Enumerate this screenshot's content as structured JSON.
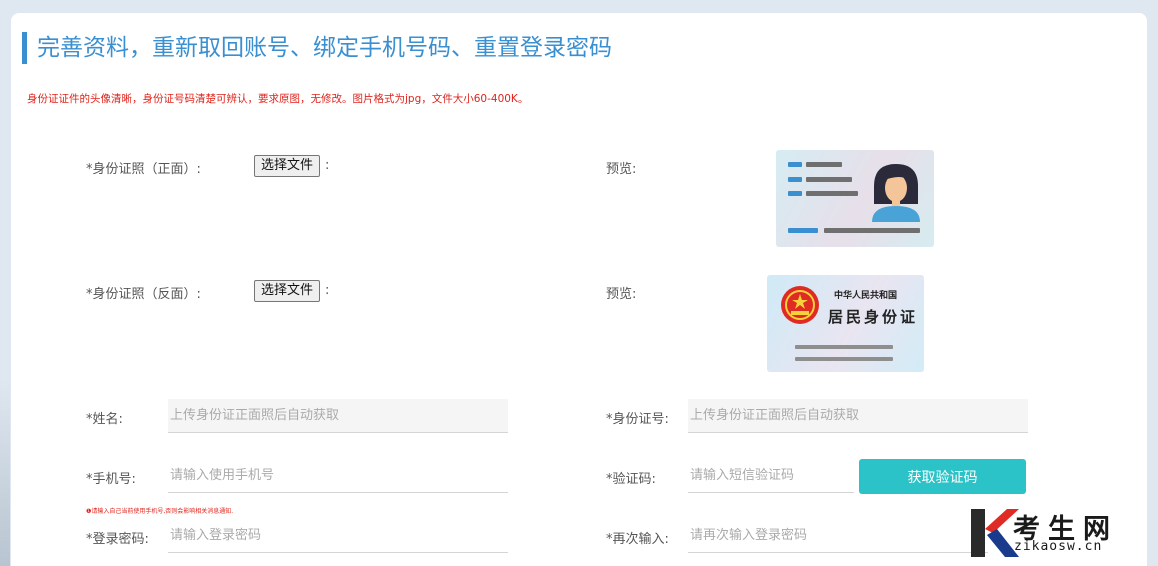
{
  "header": {
    "title": "完善资料，重新取回账号、绑定手机号码、重置登录密码",
    "notice": "身份证证件的头像清晰，身份证号码清楚可辨认，要求原图，无修改。图片格式为jpg，文件大小60-400K。"
  },
  "upload": {
    "front_label": "*身份证照（正面）:",
    "back_label": "*身份证照（反面）:",
    "choose_file": "选择文件",
    "colon": ":",
    "preview_label": "预览:"
  },
  "front_card": {
    "colors": [
      "#3a8fd0",
      "#6f6f6f",
      "#f5c59a",
      "#2a2a3a",
      "#4aa3d6"
    ]
  },
  "back_card": {
    "line1": "中华人民共和国",
    "line2": "居民身份证",
    "colors": [
      "#e02a24",
      "#f5d13a",
      "#8e8e8e"
    ]
  },
  "form": {
    "name_label": "*姓名:",
    "name_placeholder": "上传身份证正面照后自动获取",
    "idno_label": "*身份证号:",
    "idno_placeholder": "上传身份证正面照后自动获取",
    "phone_label": "*手机号:",
    "phone_placeholder": "请输入使用手机号",
    "phone_hint": "❶请输入自己当前使用手机号,否则会影响相关消息通知.",
    "code_label": "*验证码:",
    "code_placeholder": "请输入短信验证码",
    "code_button": "获取验证码",
    "pwd_label": "*登录密码:",
    "pwd_placeholder": "请输入登录密码",
    "repwd_label": "*再次输入:",
    "repwd_placeholder": "请再次输入登录密码"
  },
  "watermark": {
    "cn": "考生网",
    "en": "zikaosw.cn",
    "colors": [
      "#2a2a2a",
      "#e02a24",
      "#1a3a8c"
    ]
  }
}
